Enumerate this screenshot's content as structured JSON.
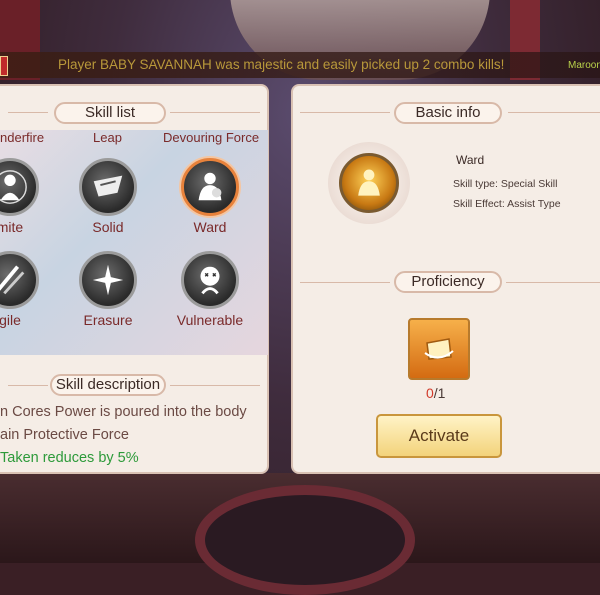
{
  "announcement": {
    "message": "Player BABY SAVANNAH was majestic and easily picked up 2 combo kills!",
    "side_name": "Maroon"
  },
  "skill_list": {
    "title": "Skill list",
    "top_labels": [
      "nderfire",
      "Leap",
      "Devouring Force"
    ],
    "skills": [
      {
        "label": "mite",
        "icon": "figure-aura-icon",
        "selected": false
      },
      {
        "label": "Solid",
        "icon": "shield-bird-icon",
        "selected": false
      },
      {
        "label": "Ward",
        "icon": "guardian-figure-icon",
        "selected": true
      },
      {
        "label": "gile",
        "icon": "speed-lines-icon",
        "selected": false
      },
      {
        "label": "Erasure",
        "icon": "burst-icon",
        "selected": false
      },
      {
        "label": "Vulnerable",
        "icon": "hurt-face-icon",
        "selected": false
      }
    ]
  },
  "skill_description": {
    "title": "Skill description",
    "lines": [
      "n Cores Power is poured into the body",
      "ain Protective Force"
    ],
    "effect_line": "Taken reduces by 5%"
  },
  "basic_info": {
    "title": "Basic info",
    "name": "Ward",
    "skill_type": "Skill type: Special Skill",
    "skill_effect": "Skill Effect: Assist Type"
  },
  "proficiency": {
    "title": "Proficiency",
    "current": "0",
    "max": "/1",
    "icon": "proficiency-scroll-icon"
  },
  "activate_button": {
    "label": "Activate"
  },
  "colors": {
    "accent_orange": "#e8823b",
    "effect_green": "#2d9a3a",
    "count_red": "#d13a2a"
  }
}
